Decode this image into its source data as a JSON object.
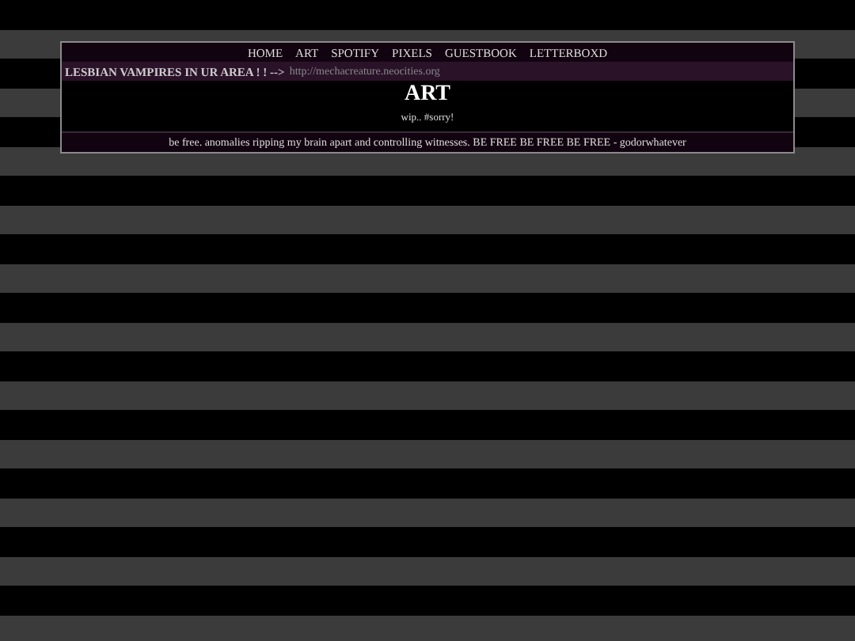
{
  "nav": [
    {
      "label": "HOME"
    },
    {
      "label": "ART"
    },
    {
      "label": "SPOTIFY"
    },
    {
      "label": "PIXELS"
    },
    {
      "label": "GUESTBOOK"
    },
    {
      "label": "LETTERBOXD"
    }
  ],
  "marquee": {
    "text": "LESBIAN VAMPIRES IN UR AREA ! ! -->",
    "link": "http://mechacreature.neocities.org"
  },
  "title": "ART",
  "note": "wip.. #sorry!",
  "footer": "be free. anomalies ripping my brain apart and controlling witnesses. BE FREE BE FREE BE FREE - godorwhatever"
}
